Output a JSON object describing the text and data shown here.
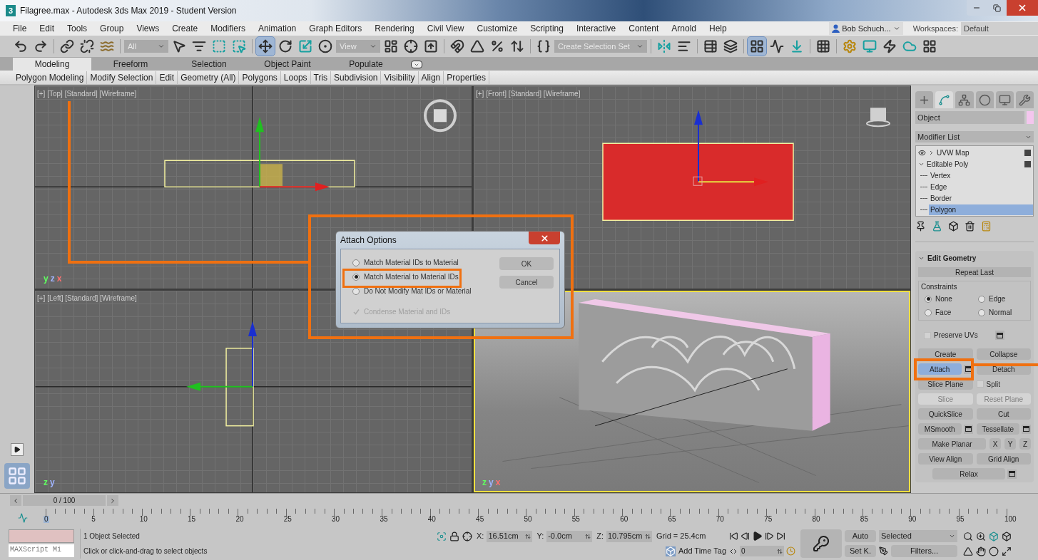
{
  "window": {
    "app_icon": "3",
    "title": "Filagree.max - Autodesk 3ds Max 2019 - Student Version"
  },
  "menu": [
    "File",
    "Edit",
    "Tools",
    "Group",
    "Views",
    "Create",
    "Modifiers",
    "Animation",
    "Graph Editors",
    "Rendering",
    "Civil View",
    "Customize",
    "Scripting",
    "Interactive",
    "Content",
    "Arnold",
    "Help"
  ],
  "user": {
    "name": "Bob Schuch..."
  },
  "workspaces": {
    "label": "Workspaces:",
    "value": "Default"
  },
  "toolbar": {
    "selection_filter": "All",
    "reference_coord": "View",
    "selection_set": "Create Selection Set"
  },
  "ribbon_tabs": [
    {
      "label": "Modeling",
      "selected": true
    },
    {
      "label": "Freeform",
      "selected": false
    },
    {
      "label": "Selection",
      "selected": false
    },
    {
      "label": "Object Paint",
      "selected": false
    },
    {
      "label": "Populate",
      "selected": false
    }
  ],
  "ribbon_panels": [
    "Polygon Modeling",
    "Modify Selection",
    "Edit",
    "Geometry (All)",
    "Polygons",
    "Loops",
    "Tris",
    "Subdivision",
    "Visibility",
    "Align",
    "Properties"
  ],
  "viewports": [
    {
      "kind": "top",
      "label": "[+] [Top] [Standard] [Wireframe]",
      "active": false,
      "tripod": [
        "y",
        "z",
        "x"
      ]
    },
    {
      "kind": "front",
      "label": "[+] [Front] [Standard] [Wireframe]",
      "active": false
    },
    {
      "kind": "left",
      "label": "[+] [Left] [Standard] [Wireframe]",
      "active": false,
      "tripod": [
        "z",
        "y"
      ]
    },
    {
      "kind": "perspective",
      "active": true,
      "tripod": [
        "z",
        "y",
        "x"
      ]
    }
  ],
  "dialog": {
    "title": "Attach Options",
    "options": [
      {
        "label": "Match Material IDs to Material",
        "selected": false
      },
      {
        "label": "Match Material to Material IDs",
        "selected": true
      },
      {
        "label": "Do Not Modify Mat IDs or Material",
        "selected": false
      }
    ],
    "condense": {
      "label": "Condense Material and IDs",
      "checked": true,
      "disabled": true
    },
    "buttons": [
      "OK",
      "Cancel"
    ]
  },
  "command_panel": {
    "tabs": [
      {
        "kind": "create",
        "selected": false
      },
      {
        "kind": "modify",
        "selected": true
      },
      {
        "kind": "hierarchy",
        "selected": false
      },
      {
        "kind": "motion",
        "selected": false
      },
      {
        "kind": "display",
        "selected": false
      },
      {
        "kind": "utilities",
        "selected": false
      }
    ],
    "object": {
      "value": "Object",
      "color": "#f4c6ee"
    },
    "modifier_list": "Modifier List",
    "stack": [
      {
        "label": "UVW Map",
        "expanded": false
      },
      {
        "label": "Editable Poly",
        "expanded": true,
        "children": [
          {
            "label": "Vertex",
            "selected": false
          },
          {
            "label": "Edge",
            "selected": false
          },
          {
            "label": "Border",
            "selected": false
          },
          {
            "label": "Polygon",
            "selected": true
          }
        ]
      }
    ],
    "rollout": {
      "title": "Edit Geometry",
      "expanded": true,
      "repeat_last": "Repeat Last",
      "constraints": {
        "label": "Constraints",
        "options": [
          {
            "label": "None",
            "selected": true
          },
          {
            "label": "Edge",
            "selected": false
          },
          {
            "label": "Face",
            "selected": false
          },
          {
            "label": "Normal",
            "selected": false
          }
        ]
      },
      "preserve_uvs": {
        "label": "Preserve UVs",
        "checked": false
      },
      "rows": [
        [
          {
            "kind": "button",
            "label": "Create",
            "active": false,
            "disabled": false,
            "settings": false
          },
          {
            "kind": "button",
            "label": "Collapse",
            "active": false,
            "disabled": false,
            "settings": false
          }
        ],
        [
          {
            "kind": "button",
            "label": "Attach",
            "active": true,
            "disabled": false,
            "settings": true
          },
          {
            "kind": "button",
            "label": "Detach",
            "active": false,
            "disabled": false,
            "settings": false
          }
        ],
        [
          {
            "kind": "button",
            "label": "Slice Plane",
            "active": false,
            "disabled": false,
            "settings": false
          },
          {
            "kind": "checkbox",
            "label": "Split",
            "checked": false
          }
        ],
        [
          {
            "kind": "button",
            "label": "Slice",
            "active": false,
            "disabled": true,
            "settings": false
          },
          {
            "kind": "button",
            "label": "Reset Plane",
            "active": false,
            "disabled": true,
            "settings": false
          }
        ],
        [
          {
            "kind": "button",
            "label": "QuickSlice",
            "active": false,
            "disabled": false,
            "settings": false
          },
          {
            "kind": "button",
            "label": "Cut",
            "active": false,
            "disabled": false,
            "settings": false
          }
        ],
        [
          {
            "kind": "button",
            "label": "MSmooth",
            "active": false,
            "disabled": false,
            "settings": true
          },
          {
            "kind": "button",
            "label": "Tessellate",
            "active": false,
            "disabled": false,
            "settings": true
          }
        ],
        [
          {
            "kind": "button",
            "label": "Make Planar",
            "active": false,
            "disabled": false,
            "settings": false
          },
          {
            "kind": "axis",
            "label": "X",
            "active": false,
            "disabled": false,
            "settings": false
          },
          {
            "kind": "axis",
            "label": "Y",
            "active": false,
            "disabled": false,
            "settings": false
          },
          {
            "kind": "axis",
            "label": "Z",
            "active": false,
            "disabled": false,
            "settings": false
          }
        ],
        [
          {
            "kind": "button",
            "label": "View Align",
            "active": false,
            "disabled": false,
            "settings": false
          },
          {
            "kind": "button",
            "label": "Grid Align",
            "active": false,
            "disabled": false,
            "settings": false
          }
        ],
        [
          {
            "kind": "button",
            "label": "Relax",
            "active": false,
            "disabled": false,
            "settings": true
          }
        ]
      ]
    }
  },
  "timeline": {
    "position": "0 / 100",
    "labels": [
      "0",
      "5",
      "10",
      "15",
      "20",
      "25",
      "30",
      "35",
      "40",
      "45",
      "50",
      "55",
      "60",
      "65",
      "70",
      "75",
      "80",
      "85",
      "90",
      "95",
      "100"
    ]
  },
  "status": {
    "listener": "MAXScript Mi",
    "selected": "1 Object Selected",
    "prompt": "Click or click-and-drag to select objects",
    "coords": [
      {
        "label": "X:",
        "value": "16.51cm"
      },
      {
        "label": "Y:",
        "value": "-0.0cm"
      },
      {
        "label": "Z:",
        "value": "10.795cm"
      }
    ],
    "grid": "Grid = 25.4cm",
    "time_tag": "Add Time Tag",
    "frame": "0",
    "auto": "Auto",
    "set_key": "Set K.",
    "key_filter": "Selected",
    "filters": "Filters..."
  }
}
